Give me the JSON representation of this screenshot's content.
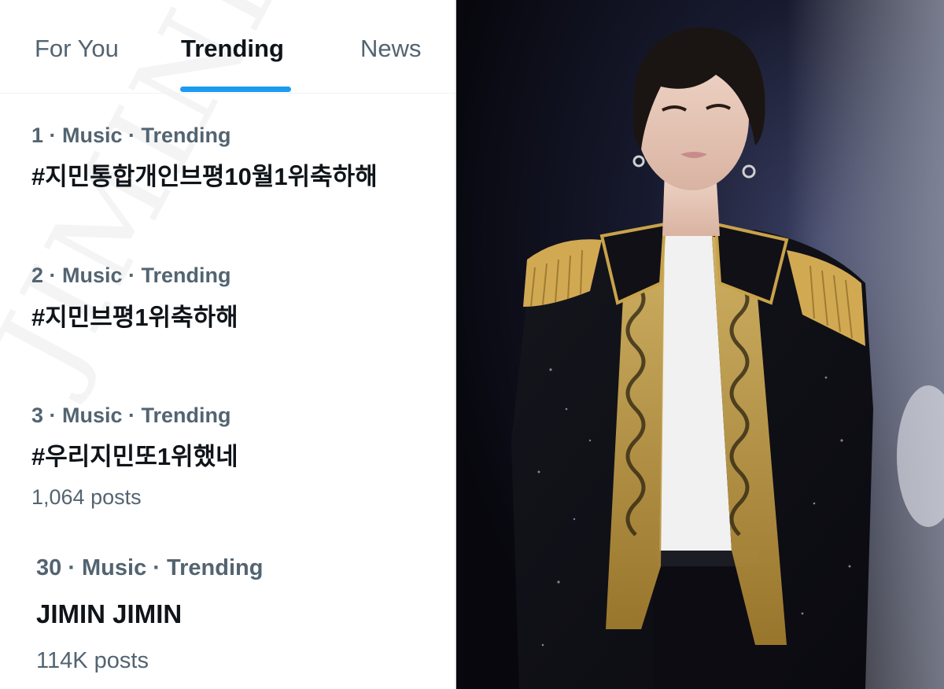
{
  "tabs": [
    {
      "label": "For You",
      "active": false
    },
    {
      "label": "Trending",
      "active": true
    },
    {
      "label": "News",
      "active": false
    }
  ],
  "trends": [
    {
      "meta": "1 · Music · Trending",
      "title": "#지민통합개인브평10월1위축하해",
      "count": ""
    },
    {
      "meta": "2 · Music · Trending",
      "title": "#지민브평1위축하해",
      "count": ""
    },
    {
      "meta": "3 · Music · Trending",
      "title": "#우리지민또1위했네",
      "count": "1,064 posts"
    },
    {
      "meta": "30 · Music · Trending",
      "title": "JIMIN JIMIN",
      "count": "114K posts"
    }
  ],
  "watermark": "JIMINDATA",
  "colors": {
    "accent": "#1d9bf0",
    "text_primary": "#0f1419",
    "text_secondary": "#536471",
    "jacket_gold": "#c9a24a"
  },
  "photo": {
    "subject_icon": "performer-photo"
  }
}
